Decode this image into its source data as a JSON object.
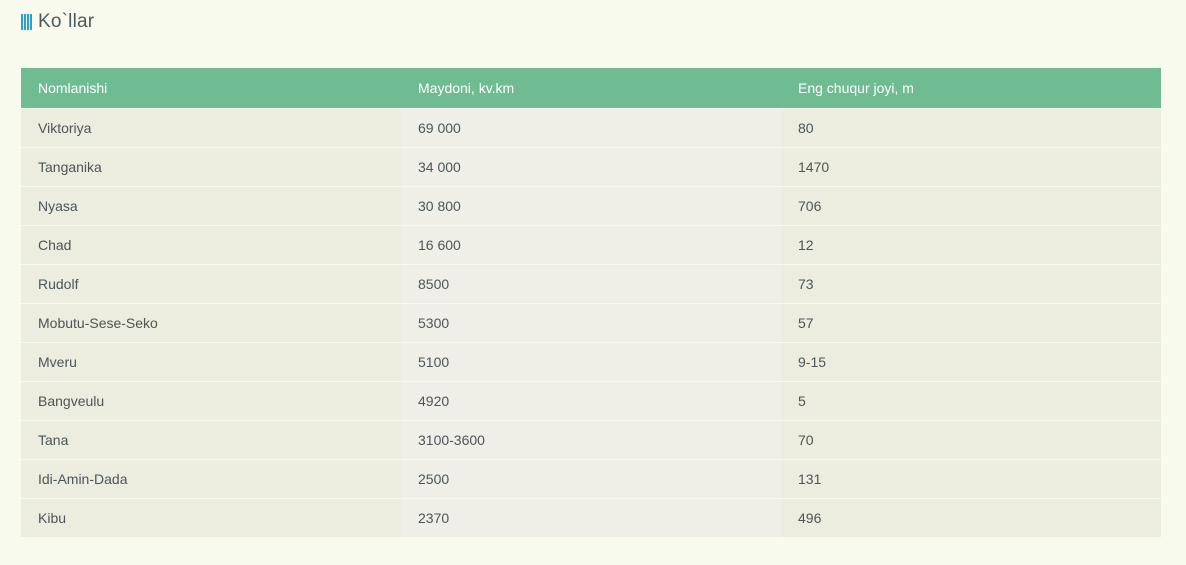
{
  "page": {
    "title": "Ko`llar",
    "icon": "bars-icon",
    "accent_color": "#2a9fd6"
  },
  "table": {
    "header_color": "#6fbb92",
    "columns": [
      "Nomlanishi",
      "Maydoni, kv.km",
      "Eng chuqur joyi, m"
    ],
    "rows": [
      [
        "Viktoriya",
        "69 000",
        "80"
      ],
      [
        "Tanganika",
        "34 000",
        "1470"
      ],
      [
        "Nyasa",
        "30 800",
        "706"
      ],
      [
        "Chad",
        "16 600",
        "12"
      ],
      [
        "Rudolf",
        "8500",
        "73"
      ],
      [
        "Mobutu-Sese-Seko",
        "5300",
        "57"
      ],
      [
        "Mveru",
        "5100",
        "9-15"
      ],
      [
        "Bangveulu",
        "4920",
        "5"
      ],
      [
        "Tana",
        "3100-3600",
        "70"
      ],
      [
        "Idi-Amin-Dada",
        "2500",
        "131"
      ],
      [
        "Kibu",
        "2370",
        "496"
      ]
    ]
  }
}
